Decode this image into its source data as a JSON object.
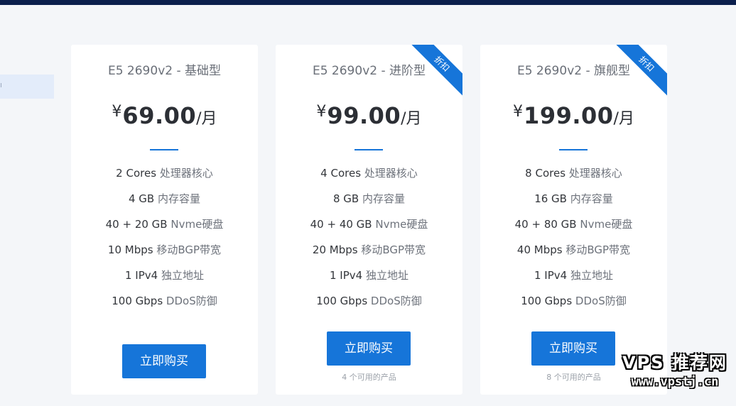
{
  "plans": [
    {
      "name": "E5 2690v2 - 基础型",
      "currency": "¥",
      "price": "69.00",
      "unit": "/月",
      "ribbon": "",
      "specs": [
        {
          "value": "2 Cores",
          "label": "处理器核心"
        },
        {
          "value": "4 GB",
          "label": "内存容量"
        },
        {
          "value": "40 + 20 GB",
          "label": "Nvme硬盘"
        },
        {
          "value": "10 Mbps",
          "label": "移动BGP带宽"
        },
        {
          "value": "1 IPv4",
          "label": "独立地址"
        },
        {
          "value": "100 Gbps",
          "label": "DDoS防御"
        }
      ],
      "buy_label": "立即购买",
      "availability": ""
    },
    {
      "name": "E5 2690v2 - 进阶型",
      "currency": "¥",
      "price": "99.00",
      "unit": "/月",
      "ribbon": "折扣",
      "specs": [
        {
          "value": "4 Cores",
          "label": "处理器核心"
        },
        {
          "value": "8 GB",
          "label": "内存容量"
        },
        {
          "value": "40 + 40 GB",
          "label": "Nvme硬盘"
        },
        {
          "value": "20 Mbps",
          "label": "移动BGP带宽"
        },
        {
          "value": "1 IPv4",
          "label": "独立地址"
        },
        {
          "value": "100 Gbps",
          "label": "DDoS防御"
        }
      ],
      "buy_label": "立即购买",
      "availability": "4 个可用的产品"
    },
    {
      "name": "E5 2690v2 - 旗舰型",
      "currency": "¥",
      "price": "199.00",
      "unit": "/月",
      "ribbon": "折扣",
      "specs": [
        {
          "value": "8 Cores",
          "label": "处理器核心"
        },
        {
          "value": "16 GB",
          "label": "内存容量"
        },
        {
          "value": "40 + 80 GB",
          "label": "Nvme硬盘"
        },
        {
          "value": "40 Mbps",
          "label": "移动BGP带宽"
        },
        {
          "value": "1 IPv4",
          "label": "独立地址"
        },
        {
          "value": "100 Gbps",
          "label": "DDoS防御"
        }
      ],
      "buy_label": "立即购买",
      "availability": "8 个可用的产品"
    }
  ],
  "watermark": {
    "line1": "VPS 推荐网",
    "line2": "www.vpstj.cn"
  },
  "colors": {
    "accent": "#1675d9",
    "topbar": "#0b1f4d",
    "page_bg": "#f4f6f9"
  }
}
